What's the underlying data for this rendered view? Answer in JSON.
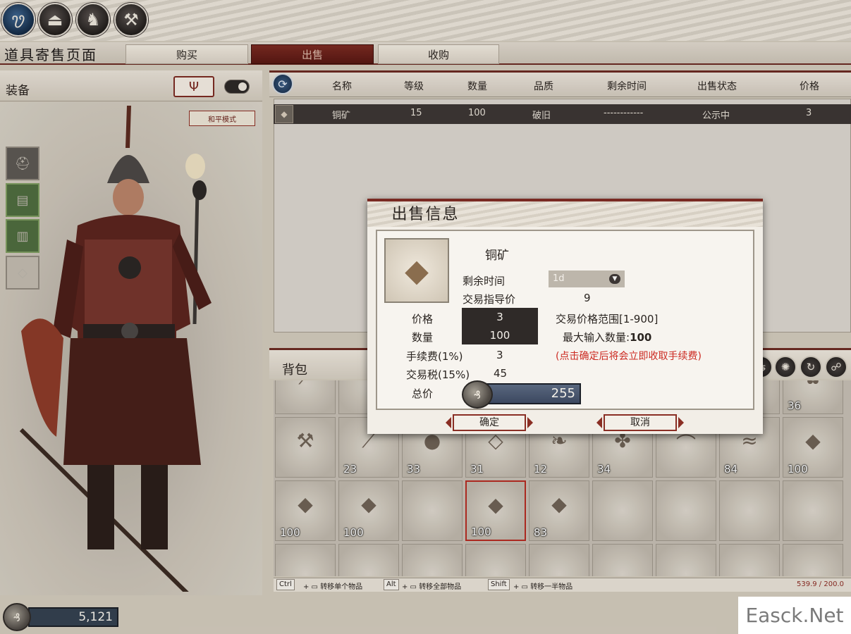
{
  "top_icons": [
    "🝣",
    "⏏",
    "♞",
    "⚒"
  ],
  "page_title": "道具寄售页面",
  "tabs": {
    "buy": "购买",
    "sell": "出售",
    "purchase": "收购"
  },
  "equip": {
    "label": "装备",
    "emblem": "Ψ",
    "peace_mode": "和平模式",
    "slots": [
      "⛑",
      "▤",
      "▥",
      "◇"
    ]
  },
  "gold": {
    "symbol": "₰",
    "amount": "5,121"
  },
  "list": {
    "headers": [
      "名称",
      "等级",
      "数量",
      "品质",
      "剩余时间",
      "出售状态",
      "价格"
    ],
    "rows": [
      {
        "icon": "◆",
        "name": "铜矿",
        "level": "15",
        "qty": "100",
        "quality": "破旧",
        "time": "------------",
        "status": "公示中",
        "price": "3"
      }
    ]
  },
  "backpack": {
    "title": "背包",
    "tools": [
      "⇆",
      "✺",
      "↻",
      "☍"
    ],
    "rows": [
      [
        {
          "g": "⟋",
          "q": ""
        },
        {
          "g": "",
          "q": ""
        },
        {
          "g": "",
          "q": ""
        },
        {
          "g": "",
          "q": ""
        },
        {
          "g": "",
          "q": ""
        },
        {
          "g": "",
          "q": ""
        },
        {
          "g": "",
          "q": ""
        },
        {
          "g": "",
          "q": ""
        },
        {
          "g": "✿",
          "q": "36"
        }
      ],
      [
        {
          "g": "⚒",
          "q": ""
        },
        {
          "g": "⟋",
          "q": "23"
        },
        {
          "g": "●",
          "q": "33"
        },
        {
          "g": "◇",
          "q": "31"
        },
        {
          "g": "❧",
          "q": "12"
        },
        {
          "g": "✤",
          "q": "34"
        },
        {
          "g": "⌒",
          "q": ""
        },
        {
          "g": "≈",
          "q": "84"
        },
        {
          "g": "◆",
          "q": "100"
        }
      ],
      [
        {
          "g": "◆",
          "q": "100"
        },
        {
          "g": "◆",
          "q": "100"
        },
        {
          "g": "",
          "q": ""
        },
        {
          "g": "◆",
          "q": "100"
        },
        {
          "g": "◆",
          "q": "83"
        },
        {
          "g": "",
          "q": ""
        },
        {
          "g": "",
          "q": ""
        },
        {
          "g": "",
          "q": ""
        },
        {
          "g": "",
          "q": ""
        }
      ],
      [
        {
          "g": "",
          "q": ""
        },
        {
          "g": "",
          "q": ""
        },
        {
          "g": "",
          "q": ""
        },
        {
          "g": "",
          "q": ""
        },
        {
          "g": "",
          "q": ""
        },
        {
          "g": "",
          "q": ""
        },
        {
          "g": "",
          "q": ""
        },
        {
          "g": "",
          "q": ""
        },
        {
          "g": "",
          "q": ""
        }
      ]
    ],
    "hints": [
      {
        "key": "Ctrl",
        "text": "转移单个物品"
      },
      {
        "key": "Alt",
        "text": "转移全部物品"
      },
      {
        "key": "Shift",
        "text": "转移一半物品"
      }
    ],
    "weight": "539.9 / 200.0"
  },
  "modal": {
    "title": "出售信息",
    "item_name": "铜矿",
    "remaining_time_label": "剩余时间",
    "remaining_time_value": "1d",
    "guide_price_label": "交易指导价",
    "guide_price_value": "9",
    "price_label": "价格",
    "price_value": "3",
    "price_range": "交易价格范围[1-900]",
    "qty_label": "数量",
    "qty_value": "100",
    "max_qty_label": "最大输入数量:",
    "max_qty_value": "100",
    "fee_label": "手续费(1%)",
    "fee_value": "3",
    "fee_warning": "(点击确定后将会立即收取手续费)",
    "tax_label": "交易税(15%)",
    "tax_value": "45",
    "total_label": "总价",
    "total_value": "255",
    "confirm": "确定",
    "cancel": "取消"
  },
  "watermark": "Easck.Net",
  "colors": {
    "accent_red": "#7a2a22",
    "warning_red": "#cc2a22",
    "panel": "#f2eee7"
  }
}
